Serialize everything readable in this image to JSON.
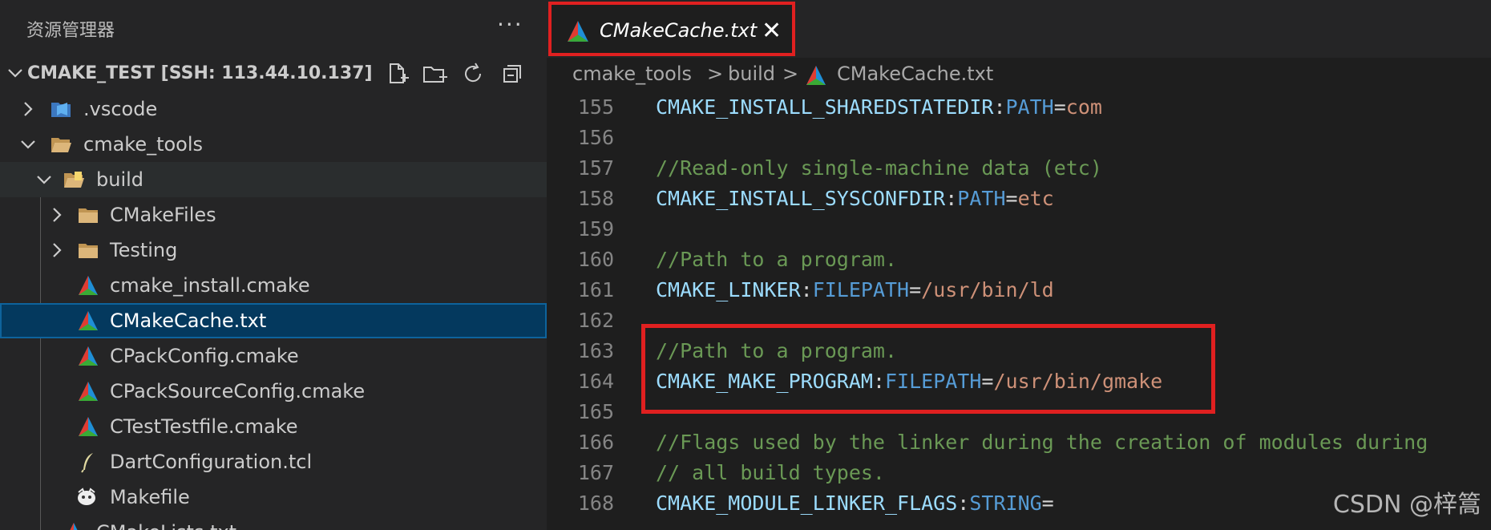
{
  "explorer": {
    "title": "资源管理器",
    "more_label": "···",
    "workspace_label": "CMAKE_TEST [SSH: 113.44.10.137]",
    "actions": [
      "new-file-icon",
      "new-folder-icon",
      "refresh-icon",
      "collapse-all-icon"
    ],
    "tree": [
      {
        "label": ".vscode",
        "icon": "vscode-folder-icon",
        "expanded": false
      },
      {
        "label": "cmake_tools",
        "icon": "folder-open-icon",
        "expanded": true
      },
      {
        "label": "build",
        "icon": "build-folder-icon",
        "expanded": true
      },
      {
        "label": "CMakeFiles",
        "icon": "folder-icon",
        "expanded": false
      },
      {
        "label": "Testing",
        "icon": "folder-icon",
        "expanded": false
      },
      {
        "label": "cmake_install.cmake",
        "icon": "cmake-icon"
      },
      {
        "label": "CMakeCache.txt",
        "icon": "cmake-icon",
        "selected": true
      },
      {
        "label": "CPackConfig.cmake",
        "icon": "cmake-icon"
      },
      {
        "label": "CPackSourceConfig.cmake",
        "icon": "cmake-icon"
      },
      {
        "label": "CTestTestfile.cmake",
        "icon": "cmake-icon"
      },
      {
        "label": "DartConfiguration.tcl",
        "icon": "feather-icon"
      },
      {
        "label": "Makefile",
        "icon": "gnu-icon"
      },
      {
        "label": "CMakeLists.txt",
        "icon": "cmake-icon"
      }
    ]
  },
  "editor": {
    "tab": {
      "label": "CMakeCache.txt",
      "close_label": "✕"
    },
    "breadcrumb": [
      "cmake_tools",
      "build",
      "CMakeCache.txt"
    ],
    "breadcrumb_sep": ">",
    "lines": [
      {
        "n": "155",
        "tokens": [
          [
            "key",
            "CMAKE_INSTALL_SHAREDSTATEDIR"
          ],
          [
            "op",
            ":"
          ],
          [
            "type",
            "PATH"
          ],
          [
            "op",
            "="
          ],
          [
            "val",
            "com"
          ]
        ]
      },
      {
        "n": "156",
        "tokens": []
      },
      {
        "n": "157",
        "tokens": [
          [
            "com",
            "//Read-only single-machine data (etc)"
          ]
        ]
      },
      {
        "n": "158",
        "tokens": [
          [
            "key",
            "CMAKE_INSTALL_SYSCONFDIR"
          ],
          [
            "op",
            ":"
          ],
          [
            "type",
            "PATH"
          ],
          [
            "op",
            "="
          ],
          [
            "val",
            "etc"
          ]
        ]
      },
      {
        "n": "159",
        "tokens": []
      },
      {
        "n": "160",
        "tokens": [
          [
            "com",
            "//Path to a program."
          ]
        ]
      },
      {
        "n": "161",
        "tokens": [
          [
            "key",
            "CMAKE_LINKER"
          ],
          [
            "op",
            ":"
          ],
          [
            "type",
            "FILEPATH"
          ],
          [
            "op",
            "="
          ],
          [
            "val",
            "/usr/bin/ld"
          ]
        ]
      },
      {
        "n": "162",
        "tokens": []
      },
      {
        "n": "163",
        "tokens": [
          [
            "com",
            "//Path to a program."
          ]
        ]
      },
      {
        "n": "164",
        "tokens": [
          [
            "key",
            "CMAKE_MAKE_PROGRAM"
          ],
          [
            "op",
            ":"
          ],
          [
            "type",
            "FILEPATH"
          ],
          [
            "op",
            "="
          ],
          [
            "val",
            "/usr/bin/gmake"
          ]
        ]
      },
      {
        "n": "165",
        "tokens": []
      },
      {
        "n": "166",
        "tokens": [
          [
            "com",
            "//Flags used by the linker during the creation of modules during"
          ]
        ]
      },
      {
        "n": "167",
        "tokens": [
          [
            "com",
            "// all build types."
          ]
        ]
      },
      {
        "n": "168",
        "tokens": [
          [
            "key",
            "CMAKE_MODULE_LINKER_FLAGS"
          ],
          [
            "op",
            ":"
          ],
          [
            "type",
            "STRING"
          ],
          [
            "op",
            "="
          ]
        ]
      }
    ]
  },
  "watermark": "CSDN @梓篙",
  "colors": {
    "highlight_border": "#e02020",
    "selected_bg": "#04395e"
  }
}
